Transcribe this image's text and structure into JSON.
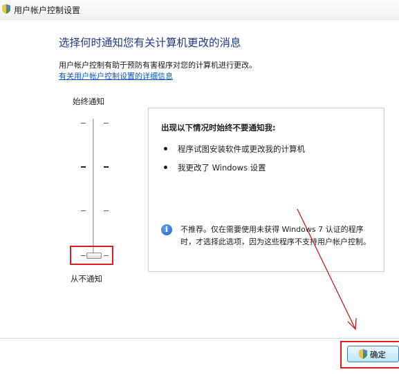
{
  "window": {
    "title": "用户帐户控制设置",
    "title_icon": "uac-shield-icon"
  },
  "main": {
    "heading": "选择何时通知您有关计算机更改的消息",
    "description": "用户帐户控制有助于预防有害程序对您的计算机进行更改。",
    "more_info_link": "有关用户帐户控制设置的详细信息"
  },
  "slider": {
    "top_label": "始终通知",
    "bottom_label": "从不通知",
    "levels": 4,
    "selected_level": 1,
    "selected_level_note": "level 1 of 4 (bottom = never notify)"
  },
  "info_panel": {
    "title": "出现以下情况时始终不要通知我:",
    "bullets": [
      "程序试图安装软件或更改我的计算机",
      "我更改了 Windows 设置"
    ],
    "warning_icon": "info-icon",
    "warning_text": "不推荐。仅在需要使用未获得 Windows 7 认证的程序时，才选择此选项，因为这些程序不支持用户帐户控制。"
  },
  "footer": {
    "ok_label": "确定",
    "ok_icon": "uac-shield-icon"
  },
  "annotations": {
    "highlight_color": "#e0191b",
    "arrow_color": "#c8191b"
  },
  "colors": {
    "heading": "#1e3a8a",
    "link": "#0b56c6",
    "button_border": "#3c7fb1"
  }
}
